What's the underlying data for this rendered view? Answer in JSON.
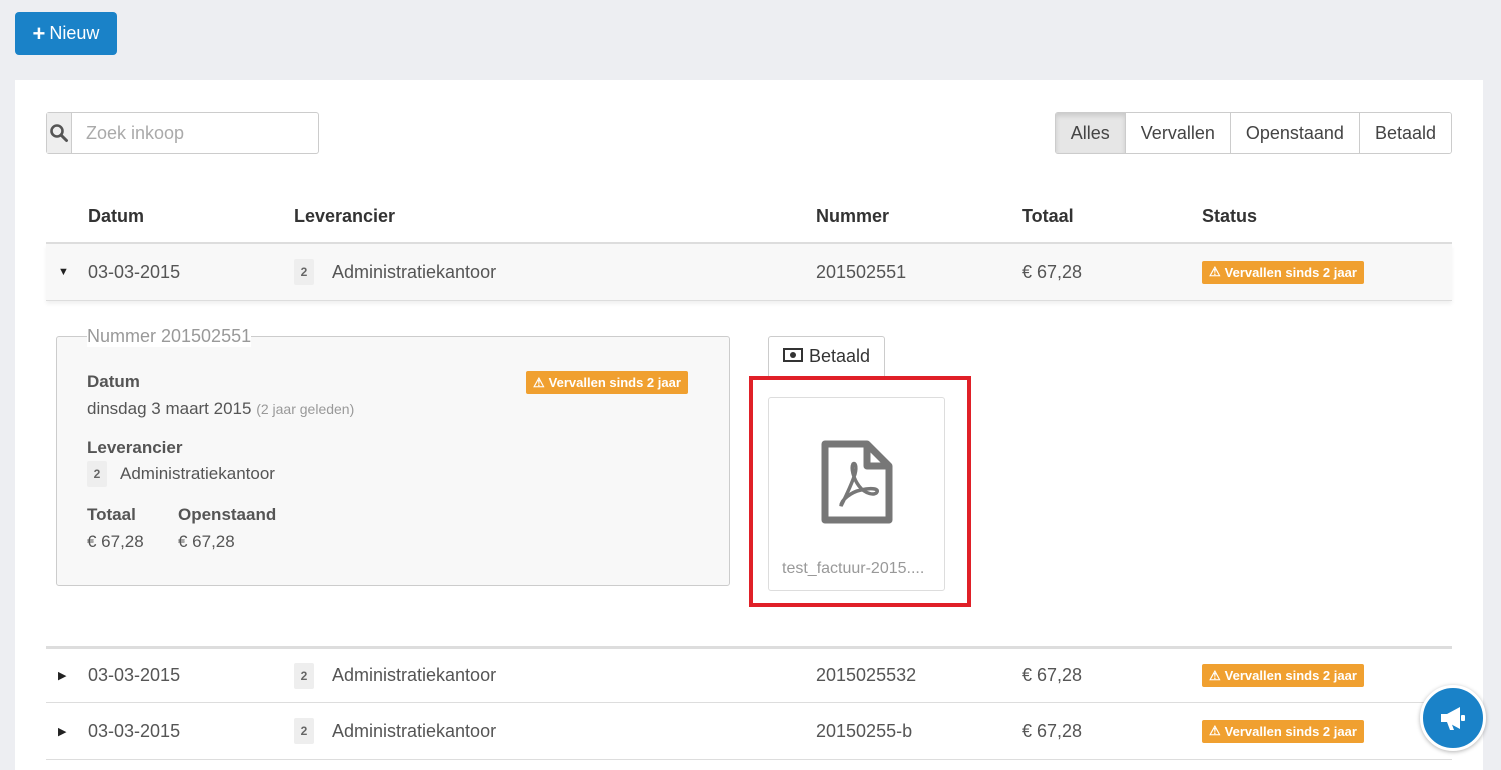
{
  "toolbar": {
    "new_label": "Nieuw",
    "new_icon": "plus-icon"
  },
  "search": {
    "placeholder": "Zoek inkoop",
    "icon": "search-icon"
  },
  "filters": {
    "alles": "Alles",
    "vervallen": "Vervallen",
    "openstaand": "Openstaand",
    "betaald": "Betaald",
    "active": "Alles"
  },
  "table": {
    "headers": {
      "datum": "Datum",
      "leverancier": "Leverancier",
      "nummer": "Nummer",
      "totaal": "Totaal",
      "status": "Status"
    },
    "rows": [
      {
        "datum": "03-03-2015",
        "badge": "2",
        "leverancier": "Administratiekantoor",
        "nummer": "201502551",
        "totaal": "€ 67,28",
        "status": "Vervallen sinds 2 jaar",
        "expanded": true
      },
      {
        "datum": "03-03-2015",
        "badge": "2",
        "leverancier": "Administratiekantoor",
        "nummer": "2015025532",
        "totaal": "€ 67,28",
        "status": "Vervallen sinds 2 jaar",
        "expanded": false
      },
      {
        "datum": "03-03-2015",
        "badge": "2",
        "leverancier": "Administratiekantoor",
        "nummer": "20150255-b",
        "totaal": "€ 67,28",
        "status": "Vervallen sinds 2 jaar",
        "expanded": false
      }
    ]
  },
  "detail": {
    "legend": "Nummer 201502551",
    "datum_label": "Datum",
    "datum_value": "dinsdag 3 maart 2015",
    "datum_relative": "(2 jaar geleden)",
    "status": "Vervallen sinds 2 jaar",
    "leverancier_label": "Leverancier",
    "leverancier_badge": "2",
    "leverancier_value": "Administratiekantoor",
    "totaal_label": "Totaal",
    "totaal_value": "€ 67,28",
    "openstaand_label": "Openstaand",
    "openstaand_value": "€ 67,28"
  },
  "attachment": {
    "paid_label": "Betaald",
    "paid_icon": "money-icon",
    "file_name": "test_factuur-2015....",
    "file_icon": "pdf-file-icon"
  },
  "colors": {
    "primary": "#1a82c8",
    "warning": "#f0a030",
    "highlight": "#e02028"
  }
}
